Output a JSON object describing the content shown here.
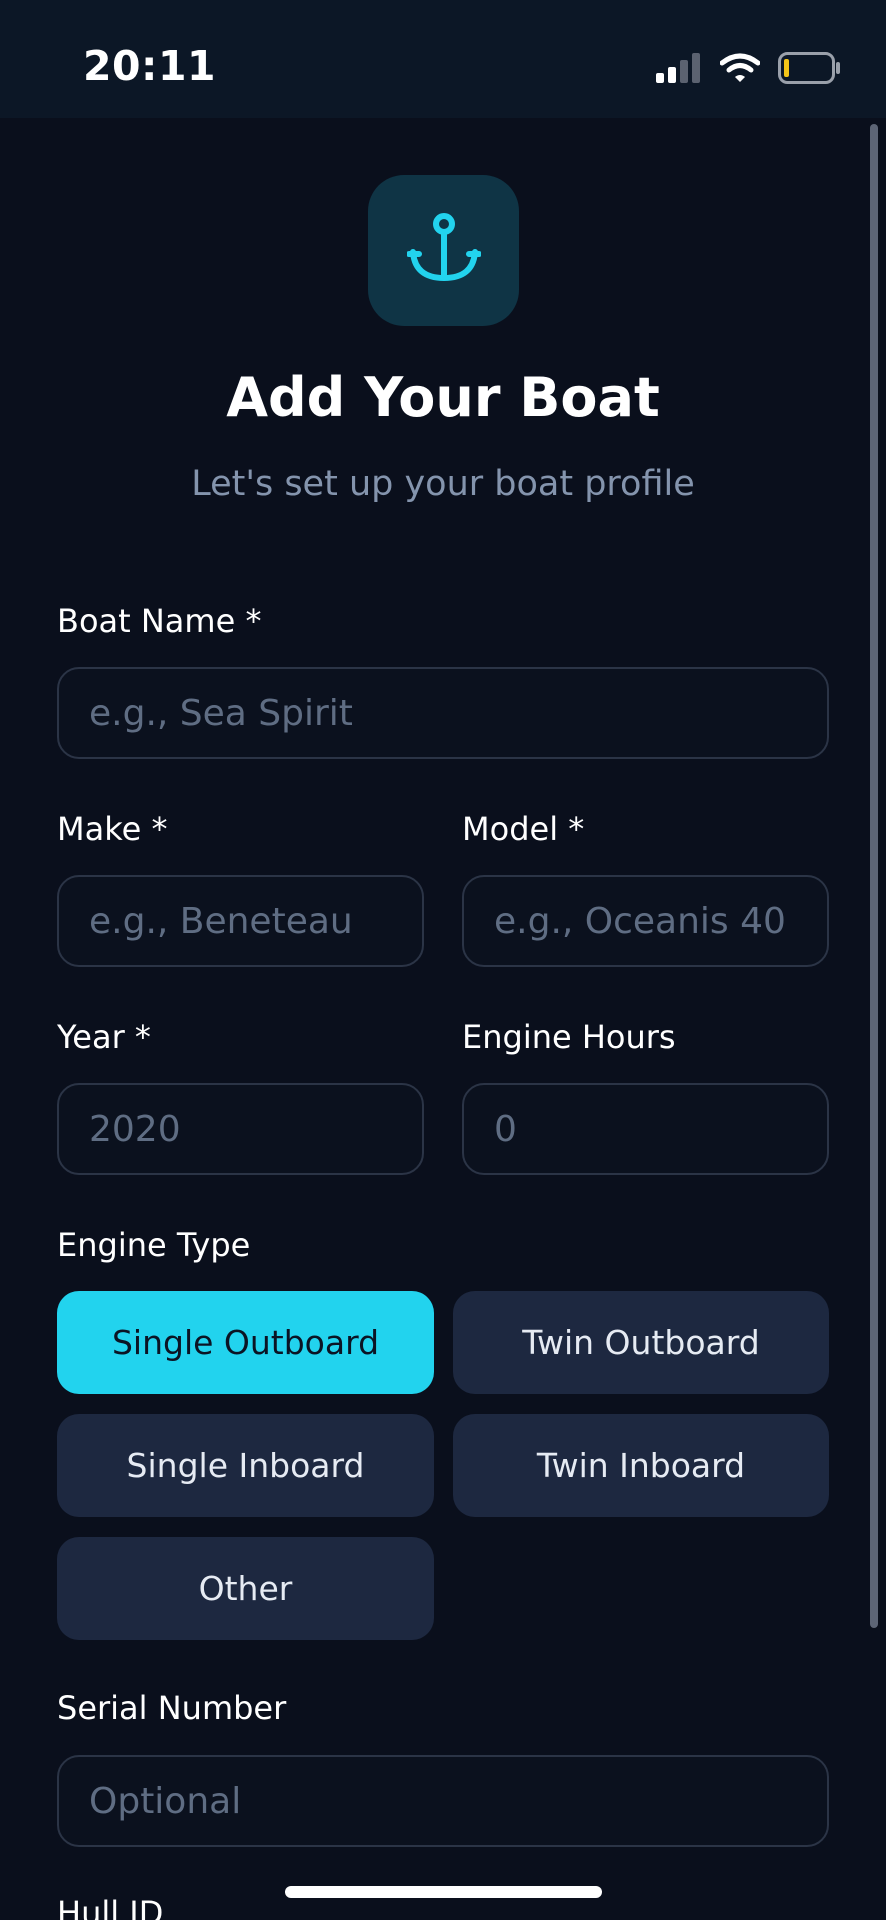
{
  "status_bar": {
    "time": "20:11",
    "signal_icon": "cellular-signal-icon",
    "wifi_icon": "wifi-icon",
    "battery_icon": "battery-low-icon"
  },
  "header": {
    "logo_icon": "anchor-icon",
    "title": "Add Your Boat",
    "subtitle": "Let's set up your boat profile"
  },
  "form": {
    "boat_name": {
      "label": "Boat Name *",
      "placeholder": "e.g., Sea Spirit",
      "value": ""
    },
    "make": {
      "label": "Make *",
      "placeholder": "e.g., Beneteau",
      "value": ""
    },
    "model": {
      "label": "Model *",
      "placeholder": "e.g., Oceanis 40",
      "value": ""
    },
    "year": {
      "label": "Year *",
      "placeholder": "2020",
      "value": ""
    },
    "engine_hours": {
      "label": "Engine Hours",
      "placeholder": "0",
      "value": ""
    },
    "engine_type": {
      "label": "Engine Type",
      "selected": "Single Outboard",
      "options": [
        "Single Outboard",
        "Twin Outboard",
        "Single Inboard",
        "Twin Inboard",
        "Other"
      ]
    },
    "serial_number": {
      "label": "Serial Number",
      "placeholder": "Optional",
      "value": ""
    },
    "hull_id": {
      "label": "Hull ID"
    }
  },
  "colors": {
    "background": "#0a0f1c",
    "accent": "#22d3ee",
    "chip": "#1d2840",
    "subtitle": "#8494ad"
  }
}
